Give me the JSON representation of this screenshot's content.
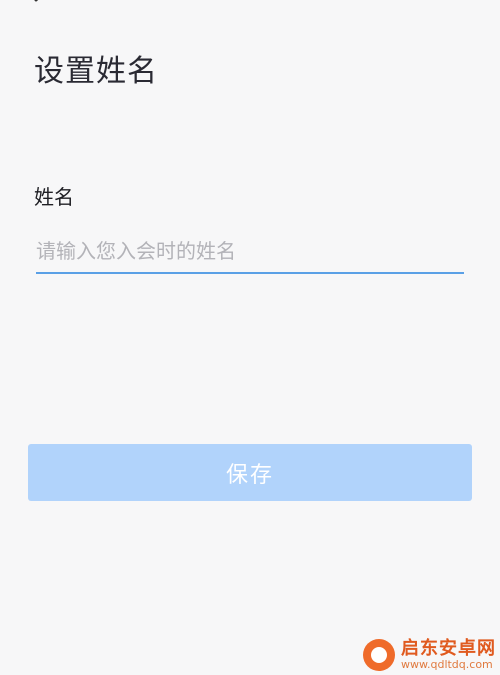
{
  "header": {
    "back_icon": "chevron-left-icon",
    "title": "设置姓名"
  },
  "form": {
    "name_label": "姓名",
    "name_value": "",
    "name_placeholder": "请输入您入会时的姓名",
    "save_label": "保存"
  },
  "watermark": {
    "name": "启东安卓网",
    "url": "www.qdltdq.com"
  },
  "colors": {
    "background": "#f7f7f8",
    "input_underline": "#5aa0e6",
    "button_disabled": "#b1d3fb",
    "watermark_accent": "#ef6b2a"
  }
}
